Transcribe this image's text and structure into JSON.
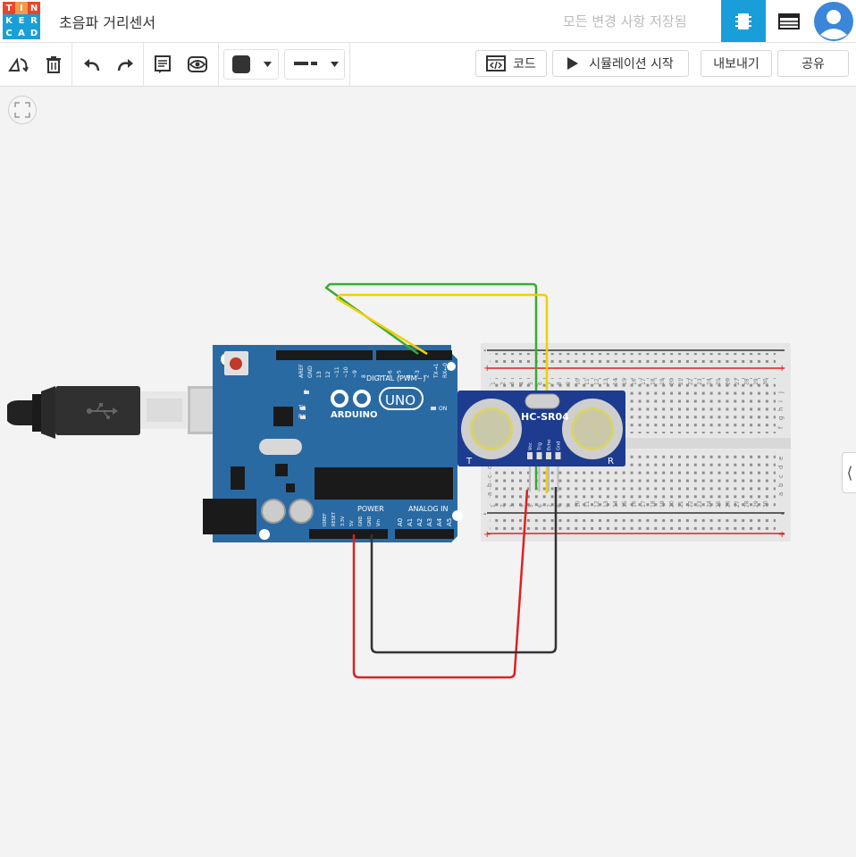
{
  "header": {
    "logo_letters": [
      "T",
      "I",
      "N",
      "K",
      "E",
      "R",
      "C",
      "A",
      "D"
    ],
    "logo_colors": [
      "#e8462a",
      "#f2994a",
      "#e8462a",
      "#1a9ed9",
      "#1a9ed9",
      "#1a9ed9",
      "#1a9ed9",
      "#1a9ed9",
      "#1a9ed9"
    ],
    "project_title": "초음파 거리센서",
    "save_status": "모든 변경 사항 저장됨",
    "view_buttons": [
      {
        "icon": "circuit-view-icon",
        "active": true,
        "color": "#1a9ed9"
      },
      {
        "icon": "component-list-icon",
        "active": false
      }
    ],
    "avatar_icon": "user-avatar-icon"
  },
  "toolbar": {
    "tools": [
      "rotate-icon",
      "delete-icon",
      "undo-icon",
      "redo-icon",
      "notes-icon",
      "visibility-icon"
    ],
    "color_swatch": "#333333",
    "line_style": "dashed",
    "code_label": "코드",
    "simulate_label": "시뮬레이션 시작",
    "export_label": "내보내기",
    "share_label": "공유"
  },
  "canvas": {
    "arduino": {
      "brand": "ARDUINO",
      "model": "UNO",
      "digital_header": "DIGITAL (PWM~)",
      "power_header": "POWER",
      "analog_header": "ANALOG IN",
      "led_labels": [
        "L",
        "TX",
        "RX"
      ],
      "on_label": "ON",
      "digital_pins": [
        "AREF",
        "GND",
        "13",
        "12",
        "~11",
        "~10",
        "~9",
        "8",
        "7",
        "~6",
        "~5",
        "4",
        "~3",
        "2",
        "TX→1",
        "RX←0"
      ],
      "power_pins": [
        "IOREF",
        "RESET",
        "3.3V",
        "5V",
        "GND",
        "GND",
        "Vin"
      ],
      "analog_pins": [
        "A0",
        "A1",
        "A2",
        "A3",
        "A4",
        "A5"
      ],
      "board_color": "#2a6aa3"
    },
    "sensor": {
      "model": "HC-SR04",
      "pins": [
        "Vcc",
        "Trig",
        "Echo",
        "Gnd"
      ],
      "left_mark": "T",
      "right_mark": "R"
    },
    "breadboard": {
      "columns": [
        "1",
        "2",
        "3",
        "4",
        "5",
        "6",
        "7",
        "8",
        "9",
        "10",
        "11",
        "12",
        "13",
        "14",
        "15",
        "16",
        "17",
        "18",
        "19",
        "20",
        "21",
        "22",
        "23",
        "24",
        "25",
        "26",
        "27",
        "28",
        "29",
        "30"
      ],
      "top_rows": [
        "j",
        "i",
        "h",
        "g",
        "f"
      ],
      "bottom_rows": [
        "e",
        "d",
        "c",
        "b",
        "a"
      ],
      "rail_minus": "-",
      "rail_plus": "+"
    },
    "wires": [
      {
        "color": "#3aaa35",
        "from": "~3",
        "to": "Trig"
      },
      {
        "color": "#f0d000",
        "from": "2",
        "to": "Echo"
      },
      {
        "color": "#e02020",
        "from": "5V",
        "to": "Vcc"
      },
      {
        "color": "#333333",
        "from": "GND",
        "to": "Gnd"
      }
    ],
    "fit_icon": "fit-view-icon",
    "panel_toggle_icon": "chevron-left-icon"
  }
}
